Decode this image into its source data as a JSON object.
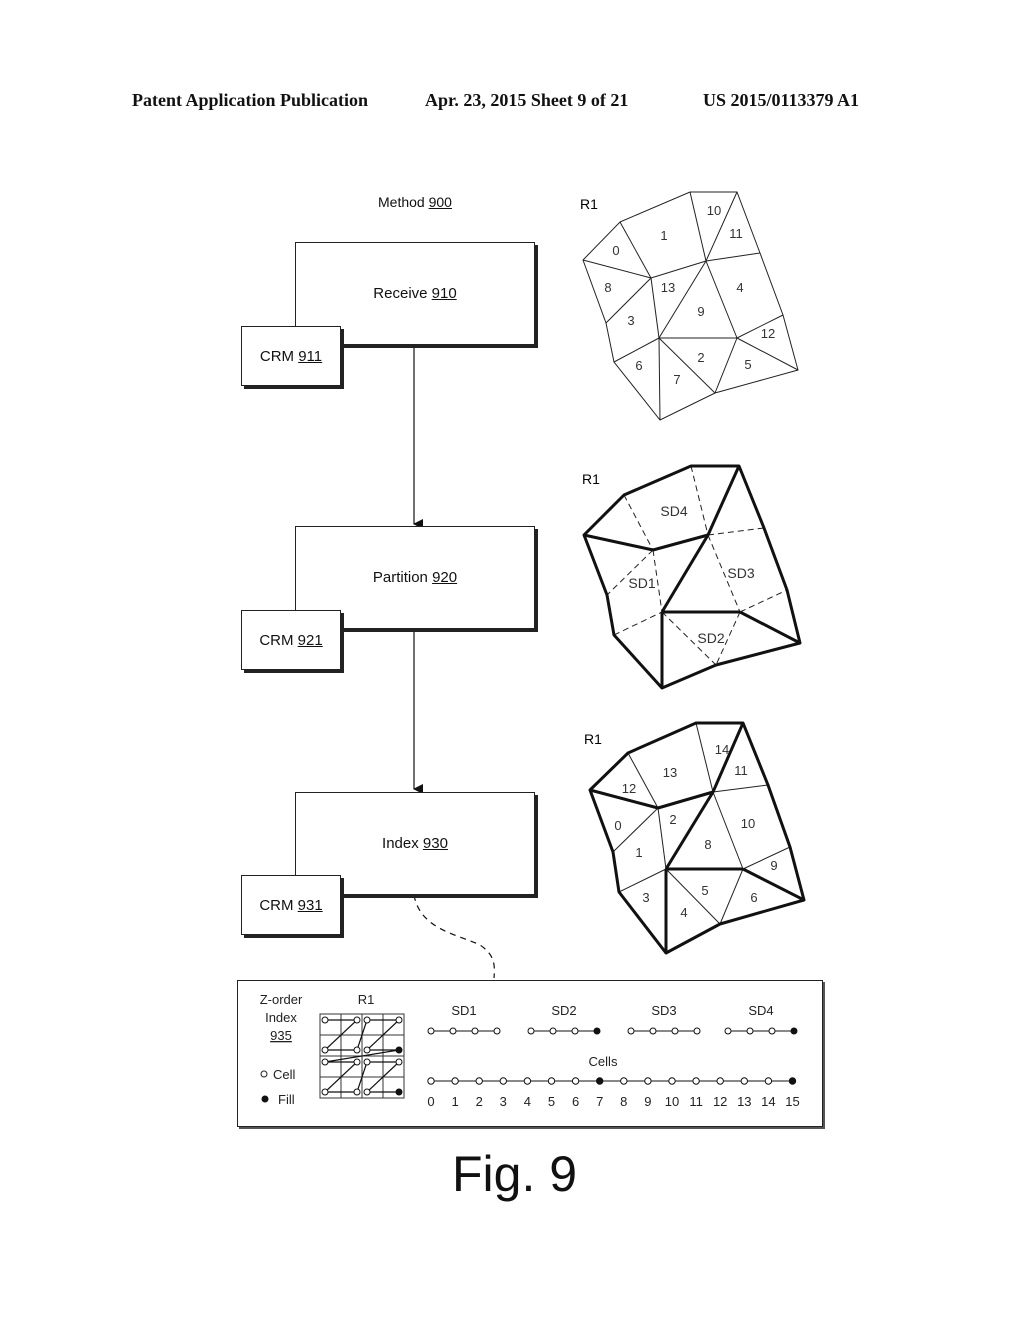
{
  "header": {
    "publication": "Patent Application Publication",
    "date_sheet": "Apr. 23, 2015  Sheet 9 of 21",
    "patent_number": "US 2015/0113379 A1"
  },
  "method": {
    "label": "Method",
    "ref": "900"
  },
  "steps": [
    {
      "label": "Receive",
      "ref": "910",
      "crm_label": "CRM",
      "crm_ref": "911"
    },
    {
      "label": "Partition",
      "ref": "920",
      "crm_label": "CRM",
      "crm_ref": "921"
    },
    {
      "label": "Index",
      "ref": "930",
      "crm_label": "CRM",
      "crm_ref": "931"
    }
  ],
  "meshes": [
    {
      "region": "R1",
      "cell_labels": [
        "0",
        "1",
        "10",
        "11",
        "8",
        "13",
        "4",
        "9",
        "3",
        "12",
        "6",
        "2",
        "5",
        "7"
      ]
    },
    {
      "region": "R1",
      "subdomains": [
        "SD4",
        "SD1",
        "SD3",
        "SD2"
      ]
    },
    {
      "region": "R1",
      "cell_labels": [
        "14",
        "13",
        "11",
        "12",
        "0",
        "2",
        "10",
        "8",
        "1",
        "9",
        "3",
        "5",
        "6",
        "4"
      ]
    }
  ],
  "zorder": {
    "title_line1": "Z-order",
    "title_line2": "Index",
    "ref": "935",
    "grid_label": "R1",
    "legend_cell": "Cell",
    "legend_fill": "Fill",
    "subdomains": [
      {
        "label": "SD1",
        "fill": [
          false,
          false,
          false,
          false
        ]
      },
      {
        "label": "SD2",
        "fill": [
          false,
          false,
          false,
          true
        ]
      },
      {
        "label": "SD3",
        "fill": [
          false,
          false,
          false,
          false
        ]
      },
      {
        "label": "SD4",
        "fill": [
          false,
          false,
          false,
          true
        ]
      }
    ],
    "cells_label": "Cells",
    "cells": [
      "0",
      "1",
      "2",
      "3",
      "4",
      "5",
      "6",
      "7",
      "8",
      "9",
      "10",
      "11",
      "12",
      "13",
      "14",
      "15"
    ],
    "filled_cells": [
      7,
      15
    ]
  },
  "figure_caption": "Fig. 9"
}
